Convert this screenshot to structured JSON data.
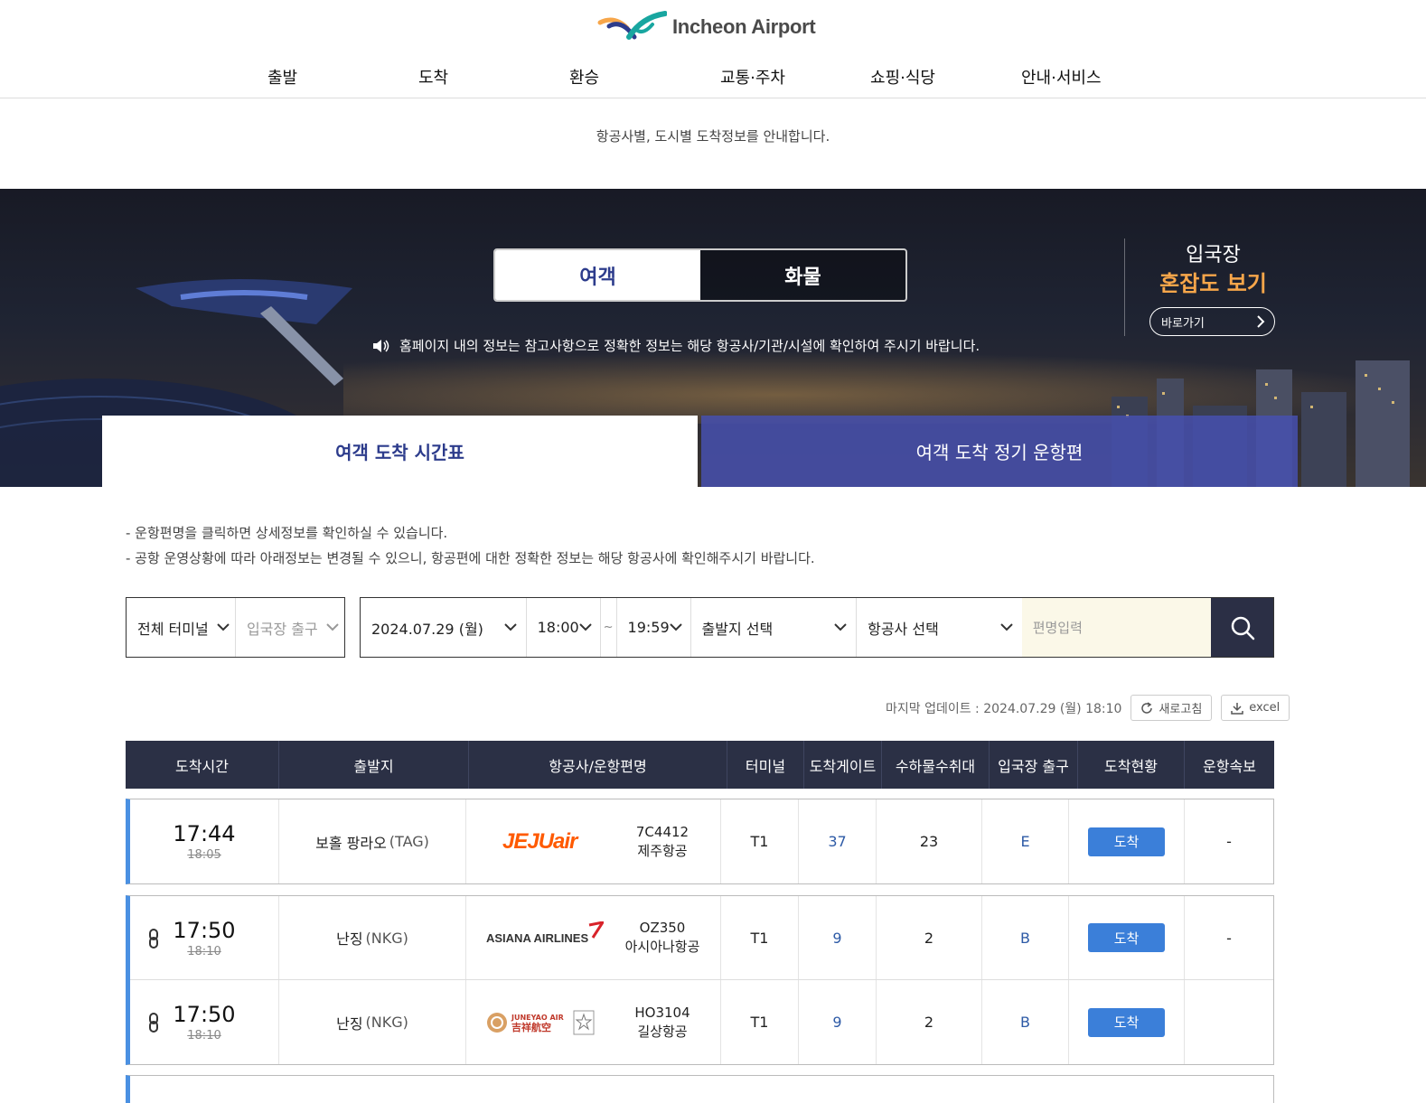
{
  "header": {
    "logo_text": "Incheon Airport",
    "nav": [
      "출발",
      "도착",
      "환승",
      "교통·주차",
      "쇼핑·식당",
      "안내·서비스"
    ]
  },
  "page": {
    "subtitle": "항공사별, 도시별 도착정보를 안내합니다."
  },
  "hero": {
    "toggle": {
      "passenger": "여객",
      "cargo": "화물"
    },
    "notice": "홈페이지 내의 정보는 참고사항으로 정확한 정보는 해당 항공사/기관/시설에 확인하여 주시기 바랍니다.",
    "congestion": {
      "line1": "입국장",
      "line2": "혼잡도 보기",
      "button": "바로가기"
    },
    "tabs": {
      "schedule": "여객 도착 시간표",
      "regular": "여객 도착 정기 운항편"
    }
  },
  "info": [
    "-  운항편명을 클릭하면 상세정보를 확인하실 수 있습니다.",
    "-  공항 운영상황에 따라 아래정보는 변경될 수 있으니, 항공편에 대한 정확한 정보는 해당 항공사에 확인해주시기 바랍니다."
  ],
  "search": {
    "terminal": "전체 터미널",
    "exit": "입국장 출구",
    "date": "2024.07.29 (월)",
    "time_from": "18:00",
    "tilde": "~",
    "time_to": "19:59",
    "origin": "출발지 선택",
    "airline": "항공사 선택",
    "flight_placeholder": "편명입력"
  },
  "update": {
    "label": "마지막 업데이트 : 2024.07.29 (월) 18:10",
    "refresh": "새로고침",
    "excel": "excel"
  },
  "table": {
    "headers": [
      "도착시간",
      "출발지",
      "항공사/운항편명",
      "터미널",
      "도착게이트",
      "수하물수취대",
      "입국장 출구",
      "도착현황",
      "운항속보"
    ],
    "rows": [
      {
        "time": "17:44",
        "scheduled": "18:05",
        "origin": "보홀 팡라오",
        "code": "(TAG)",
        "airline_logo": "JEJUair",
        "flight": "7C4412",
        "airline": "제주항공",
        "terminal": "T1",
        "gate": "37",
        "belt": "23",
        "exit": "E",
        "status": "도착",
        "news": "-"
      },
      {
        "time": "17:50",
        "scheduled": "18:10",
        "origin": "난징",
        "code": "(NKG)",
        "airline_logo": "ASIANA AIRLINES",
        "flight": "OZ350",
        "airline": "아시아나항공",
        "terminal": "T1",
        "gate": "9",
        "belt": "2",
        "exit": "B",
        "status": "도착",
        "news": "-"
      },
      {
        "time": "17:50",
        "scheduled": "18:10",
        "origin": "난징",
        "code": "(NKG)",
        "airline_logo_en": "JUNEYAO AIR",
        "airline_logo_cn": "吉祥航空",
        "flight": "HO3104",
        "airline": "길상항공",
        "terminal": "T1",
        "gate": "9",
        "belt": "2",
        "exit": "B",
        "status": "도착",
        "news": ""
      }
    ]
  },
  "colors": {
    "primary": "#2d3c8c",
    "accent": "#4a90e2",
    "status": "#3b7fd9",
    "header_bg": "#2b3045",
    "orange": "#f7a64a",
    "jeju": "#ff5a00",
    "asiana": "#d8232a"
  }
}
